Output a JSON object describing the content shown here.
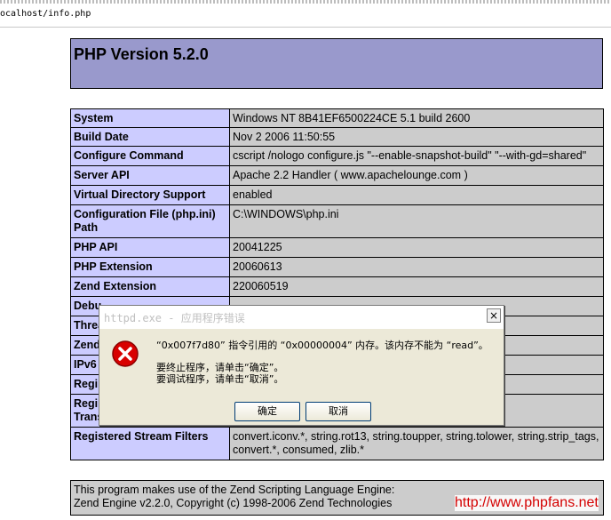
{
  "browser": {
    "address": "ocalhost/info.php"
  },
  "php": {
    "title": "PHP Version 5.2.0",
    "rows": [
      {
        "key": "System",
        "value": "Windows NT 8B41EF6500224CE 5.1 build 2600"
      },
      {
        "key": "Build Date",
        "value": "Nov 2 2006 11:50:55"
      },
      {
        "key": "Configure Command",
        "value": "cscript /nologo configure.js \"--enable-snapshot-build\" \"--with-gd=shared\""
      },
      {
        "key": "Server API",
        "value": "Apache 2.2 Handler ( www.apachelounge.com )"
      },
      {
        "key": "Virtual Directory Support",
        "value": "enabled"
      },
      {
        "key": "Configuration File (php.ini) Path",
        "value": "C:\\WINDOWS\\php.ini"
      },
      {
        "key": "PHP API",
        "value": "20041225"
      },
      {
        "key": "PHP Extension",
        "value": "20060613"
      },
      {
        "key": "Zend Extension",
        "value": "220060519"
      },
      {
        "key": "Debu",
        "value": ""
      },
      {
        "key": "Threa",
        "value": ""
      },
      {
        "key": "Zend",
        "value": ""
      },
      {
        "key": "IPv6",
        "value": ""
      },
      {
        "key": "Regi",
        "value": ""
      },
      {
        "key": "Regi\nTrans",
        "value": ""
      },
      {
        "key": "Registered Stream Filters",
        "value": "convert.iconv.*, string.rot13, string.toupper, string.tolower, string.strip_tags, convert.*, consumed, zlib.*"
      }
    ],
    "footer_line1": "This program makes use of the Zend Scripting Language Engine:",
    "footer_line2": "Zend Engine v2.2.0, Copyright (c) 1998-2006 Zend Technologies"
  },
  "watermark": "http://www.phpfans.net",
  "dialog": {
    "title": "httpd.exe - 应用程序错误",
    "close_glyph": "×",
    "message": "“0x007f7d80” 指令引用的 “0x00000004” 内存。该内存不能为 “read”。",
    "line_terminate": "要终止程序，请单击“确定”。",
    "line_debug": "要调试程序，请单击“取消”。",
    "ok_label": "确定",
    "cancel_label": "取消",
    "icon": "error-icon"
  }
}
